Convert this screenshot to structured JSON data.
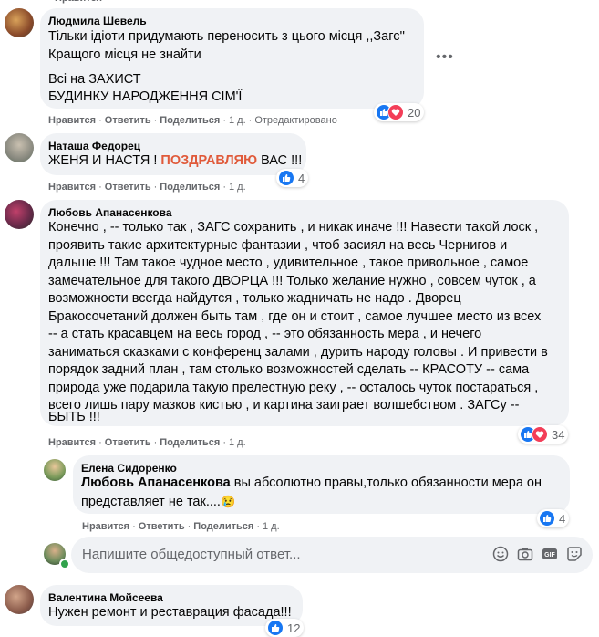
{
  "colors": {
    "bubble": "#f0f2f5",
    "link": "#65676b",
    "like": "#1877f2",
    "love": "#f33e58",
    "highlight": "#e05a3a"
  },
  "actions": {
    "like": "Нравится",
    "reply": "Ответить",
    "share": "Поделиться",
    "sep": "·"
  },
  "comments": [
    {
      "author": "Людмила Шевель",
      "lines": [
        "Тільки ідіоти придумають переносить з цього місця ,,Загс''",
        "Кращого місця не знайти",
        "",
        "Всі на ЗАХИСТ",
        "БУДИНКУ НАРОДЖЕННЯ СІМ'Ї"
      ],
      "time": "1 д.",
      "edited": "Отредактировано",
      "reactions": "20"
    },
    {
      "author": "Наташа Федорец",
      "text_before": "ЖЕНЯ И НАСТЯ ! ",
      "text_highlight": "ПОЗДРАВЛЯЮ",
      "text_after": " ВАС !!!",
      "time": "1 д.",
      "reactions": "4"
    },
    {
      "author": "Любовь Апанасенкова",
      "lines": [
        "Конечно , -- только так , ЗАГС сохранить , и никак иначе !!! Навести такой лоск ,",
        "проявить такие архитектурные фантазии , чтоб засиял на весь Чернигов и",
        "дальше !!! Там такое чудное место , удивительное , такое привольное , самое",
        "замечательное для такого ДВОРЦА !!! Только желание нужно , совсем чуток , а",
        "возможности всегда найдутся , только жадничать не надо . Дворец",
        "Бракосочетаний должен быть там , где он и стоит , самое лучшее место из всех",
        "-- а стать красавцем на весь город , -- это обязанность мера , и нечего",
        "заниматься сказками с конференц залами , дурить народу головы . И привести в",
        "порядок задний план , там столько возможностей сделать -- КРАСОТУ -- сама",
        "природа уже подарила такую прелестную реку , -- осталось чуток постараться ,",
        "всего лишь пару мазков кистью , и картина заиграет волшебством . ЗАГСу --",
        "БЫТЬ !!!"
      ],
      "time": "1 д.",
      "reactions": "34"
    },
    {
      "author": "Елена Сидоренко",
      "tag": "Любовь Апанасенкова",
      "line1_rest": " вы абсолютно правы,только обязанности мера он",
      "line2": "представляет не так....",
      "emoji": "😢",
      "time": "1 д.",
      "reactions": "4"
    },
    {
      "author": "Валентина Мойсеева",
      "text": "Нужен ремонт и реставрация фасада!!!",
      "reactions": "12"
    }
  ],
  "reply_box": {
    "placeholder": "Напишите общедоступный ответ..."
  },
  "icons": {
    "more": "more-options-icon",
    "emoji": "emoji-icon",
    "camera": "camera-icon",
    "gif": "gif-icon",
    "sticker": "sticker-icon"
  }
}
